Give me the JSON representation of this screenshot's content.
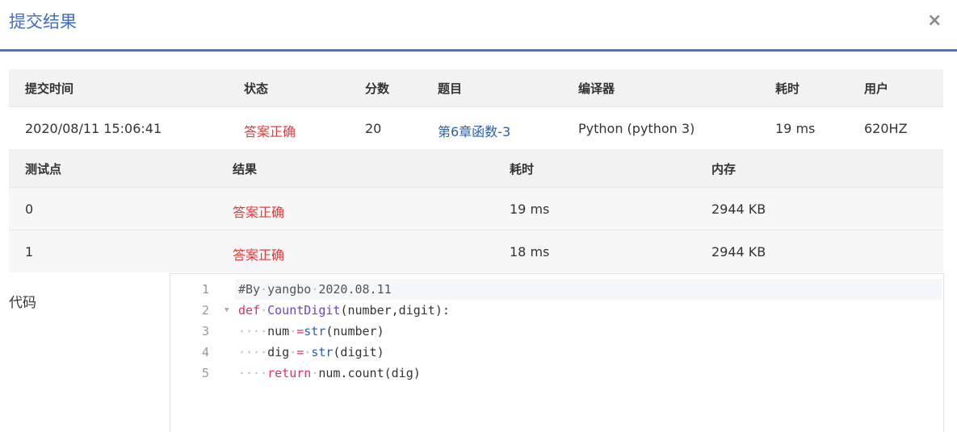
{
  "dialog": {
    "title": "提交结果",
    "close_glyph": "×"
  },
  "submission": {
    "headers": [
      "提交时间",
      "状态",
      "分数",
      "题目",
      "编译器",
      "耗时",
      "用户"
    ],
    "row": {
      "time": "2020/08/11 15:06:41",
      "status": "答案正确",
      "score": "20",
      "problem": "第6章函数-3",
      "compiler": "Python (python 3)",
      "elapsed": "19 ms",
      "user": "620HZ"
    }
  },
  "tests": {
    "headers": [
      "测试点",
      "结果",
      "耗时",
      "内存"
    ],
    "rows": [
      {
        "id": "0",
        "result": "答案正确",
        "time": "19 ms",
        "memory": "2944 KB"
      },
      {
        "id": "1",
        "result": "答案正确",
        "time": "18 ms",
        "memory": "2944 KB"
      }
    ]
  },
  "code": {
    "label": "代码",
    "line_numbers": [
      "1",
      "2",
      "3",
      "4",
      "5"
    ],
    "fold_glyph": "▼",
    "lines": [
      [
        {
          "t": "#By",
          "c": "cm"
        },
        {
          "t": "·",
          "c": "dot"
        },
        {
          "t": "yangbo",
          "c": "cm"
        },
        {
          "t": "·",
          "c": "dot"
        },
        {
          "t": "2020.08.11",
          "c": "cm"
        }
      ],
      [
        {
          "t": "def",
          "c": "kw"
        },
        {
          "t": "·",
          "c": "dot"
        },
        {
          "t": "CountDigit",
          "c": "fn"
        },
        {
          "t": "(number,digit):",
          "c": ""
        }
      ],
      [
        {
          "t": "····",
          "c": "dot"
        },
        {
          "t": "num",
          "c": ""
        },
        {
          "t": "·",
          "c": "dot"
        },
        {
          "t": "=",
          "c": "op"
        },
        {
          "t": "str",
          "c": "bi"
        },
        {
          "t": "(number)",
          "c": ""
        }
      ],
      [
        {
          "t": "····",
          "c": "dot"
        },
        {
          "t": "dig",
          "c": ""
        },
        {
          "t": "·",
          "c": "dot"
        },
        {
          "t": "=",
          "c": "op"
        },
        {
          "t": "·",
          "c": "dot"
        },
        {
          "t": "str",
          "c": "bi"
        },
        {
          "t": "(digit)",
          "c": ""
        }
      ],
      [
        {
          "t": "····",
          "c": "dot"
        },
        {
          "t": "return",
          "c": "kw"
        },
        {
          "t": "·",
          "c": "dot"
        },
        {
          "t": "num.count(dig)",
          "c": ""
        }
      ]
    ]
  },
  "colors": {
    "accent": "#3f6fc0",
    "correct": "#e4393c",
    "link": "#2a5fa8"
  }
}
